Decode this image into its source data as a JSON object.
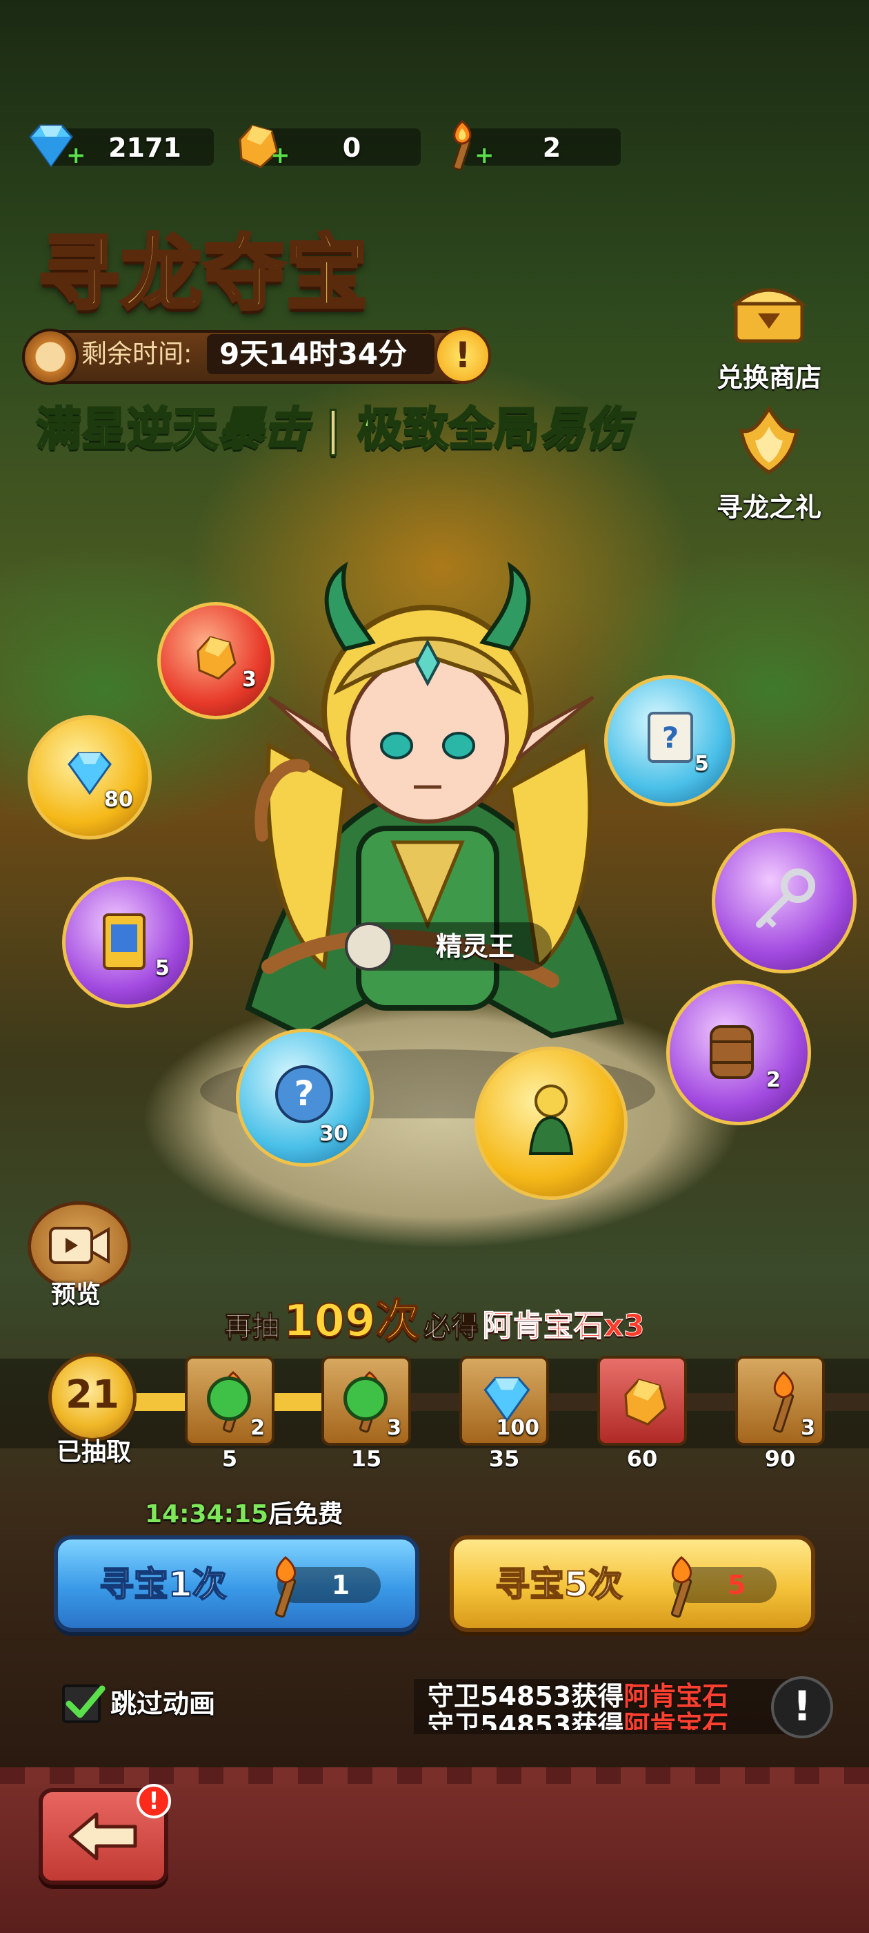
{
  "currencies": [
    {
      "icon": "diamond-icon",
      "value": "2171"
    },
    {
      "icon": "amber-gem-icon",
      "value": "0"
    },
    {
      "icon": "torch-icon",
      "value": "2"
    }
  ],
  "event": {
    "title": "寻龙夺宝",
    "timer_label": "剩余时间:",
    "timer_value": "9天14时34分",
    "slogan": {
      "p1": "满星逆天",
      "p2": "暴击",
      "sep": "|",
      "p3": "极致全局",
      "p4": "易伤"
    }
  },
  "side_buttons": [
    {
      "label": "兑换商店",
      "icon": "treasure-chest-icon"
    },
    {
      "label": "寻龙之礼",
      "icon": "golden-crest-icon"
    }
  ],
  "hero": {
    "name": "精灵王"
  },
  "orbs": [
    {
      "icon": "amber-gem-icon",
      "count": "3"
    },
    {
      "icon": "diamond-icon",
      "count": "80"
    },
    {
      "icon": "ticket-icon",
      "count": "5"
    },
    {
      "icon": "mystery-scroll-icon",
      "count": "5"
    },
    {
      "icon": "key-icon",
      "count": ""
    },
    {
      "icon": "barrel-icon",
      "count": "2"
    },
    {
      "icon": "mystery-orb-icon",
      "count": "30"
    },
    {
      "icon": "hero-figure-icon",
      "count": ""
    }
  ],
  "preview": {
    "label": "预览"
  },
  "guarantee": {
    "prefix": "再抽",
    "number": "109次",
    "middle": "必得",
    "reward": "阿肯宝石x3"
  },
  "progress": {
    "draw_count": "21",
    "draw_label": "已抽取",
    "fill_fraction": 0.3,
    "milestones": [
      {
        "threshold": "5",
        "icon": "torch-icon",
        "count": "2",
        "claimed": true
      },
      {
        "threshold": "15",
        "icon": "torch-icon",
        "count": "3",
        "claimed": true
      },
      {
        "threshold": "35",
        "icon": "diamond-icon",
        "count": "100",
        "claimed": false
      },
      {
        "threshold": "60",
        "icon": "amber-gem-icon",
        "count": "",
        "claimed": false
      },
      {
        "threshold": "90",
        "icon": "torch-icon",
        "count": "3",
        "claimed": false
      }
    ]
  },
  "free_timer": {
    "time": "14:34:15",
    "suffix": "后免费"
  },
  "actions": {
    "single": {
      "label": "寻宝1次",
      "cost": "1"
    },
    "five": {
      "label": "寻宝5次",
      "cost": "5"
    }
  },
  "skip_animation": {
    "label": "跳过动画",
    "checked": true
  },
  "log": [
    {
      "player": "守卫54853获得",
      "item": "阿肯宝石"
    },
    {
      "player": "守卫54853获得",
      "item": "阿肯宝石"
    }
  ],
  "colors": {
    "accent_gold": "#ffd53a",
    "reward_red": "#ff3c2a",
    "free_green": "#7ee85a"
  }
}
